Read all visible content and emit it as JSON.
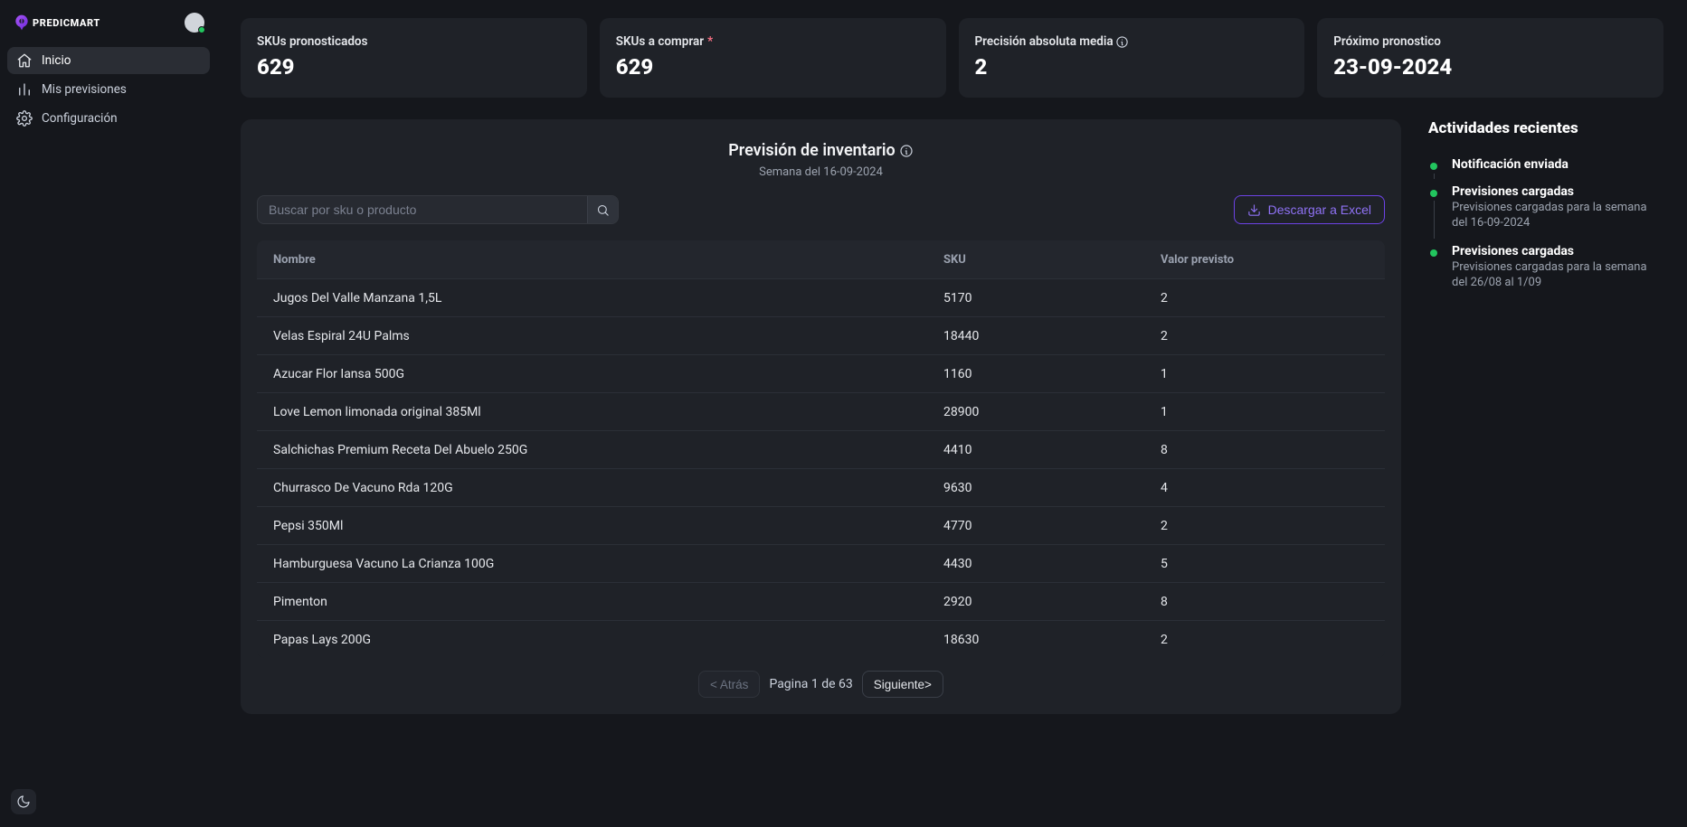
{
  "brand": {
    "name": "PREDICMART"
  },
  "sidebar": {
    "items": [
      {
        "label": "Inicio"
      },
      {
        "label": "Mis previsiones"
      },
      {
        "label": "Configuración"
      }
    ]
  },
  "kpis": [
    {
      "title": "SKUs pronosticados",
      "value": "629"
    },
    {
      "title": "SKUs a comprar",
      "value": "629"
    },
    {
      "title": "Precisión absoluta media",
      "value": "2"
    },
    {
      "title": "Próximo pronostico",
      "value": "23-09-2024"
    }
  ],
  "panel": {
    "title": "Previsión de inventario",
    "subtitle": "Semana del 16-09-2024",
    "search": {
      "placeholder": "Buscar por sku o producto"
    },
    "download": {
      "label": "Descargar a Excel"
    },
    "columns": {
      "name": "Nombre",
      "sku": "SKU",
      "value": "Valor previsto"
    },
    "rows": [
      {
        "name": "Jugos Del Valle Manzana 1,5L",
        "sku": "5170",
        "value": "2"
      },
      {
        "name": "Velas Espiral 24U Palms",
        "sku": "18440",
        "value": "2"
      },
      {
        "name": "Azucar Flor Iansa 500G",
        "sku": "1160",
        "value": "1"
      },
      {
        "name": "Love Lemon limonada original 385Ml",
        "sku": "28900",
        "value": "1"
      },
      {
        "name": "Salchichas Premium Receta Del Abuelo 250G",
        "sku": "4410",
        "value": "8"
      },
      {
        "name": "Churrasco De Vacuno Rda 120G",
        "sku": "9630",
        "value": "4"
      },
      {
        "name": "Pepsi 350Ml",
        "sku": "4770",
        "value": "2"
      },
      {
        "name": "Hamburguesa Vacuno La Crianza 100G",
        "sku": "4430",
        "value": "5"
      },
      {
        "name": "Pimenton",
        "sku": "2920",
        "value": "8"
      },
      {
        "name": "Papas Lays 200G",
        "sku": "18630",
        "value": "2"
      }
    ],
    "paginator": {
      "prev": "< Atrás",
      "label": "Pagina 1 de 63",
      "next": "Siguiente>"
    }
  },
  "activities": {
    "title": "Actividades recientes",
    "items": [
      {
        "title": "Notificación enviada",
        "desc": ""
      },
      {
        "title": "Previsiones cargadas",
        "desc": "Previsiones cargadas para la semana del 16-09-2024"
      },
      {
        "title": "Previsiones cargadas",
        "desc": "Previsiones cargadas para la semana del 26/08 al 1/09"
      }
    ]
  }
}
